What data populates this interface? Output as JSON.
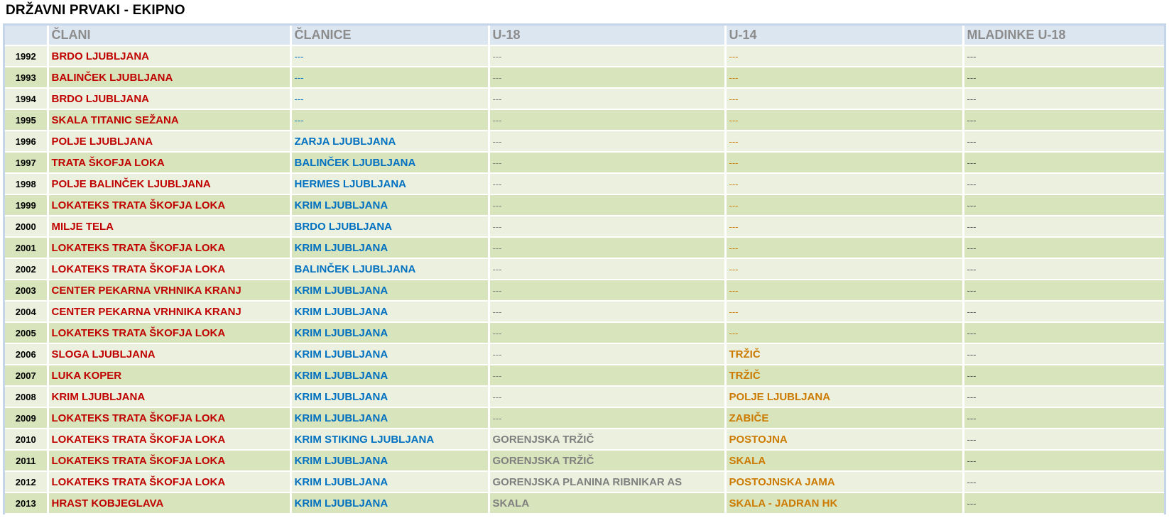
{
  "title": "DRŽAVNI PRVAKI - EKIPNO",
  "headers": {
    "year": "",
    "clani": "ČLANI",
    "clanice": "ČLANICE",
    "u18": "U-18",
    "u14": "U-14",
    "mladinke": "MLADINKE U-18"
  },
  "colors": {
    "clani": "#c00000",
    "clanice": "#0070c0",
    "u18": "#7f7f7f",
    "u14": "#cc7a00",
    "header_bg": "#dce6f1",
    "row_light": "#ebf1de",
    "row_dark": "#d8e4bc"
  },
  "rows": [
    {
      "year": "1992",
      "clani": "BRDO LJUBLJANA",
      "clanice": "---",
      "u18": "---",
      "u14": "---",
      "mladinke": "---"
    },
    {
      "year": "1993",
      "clani": "BALINČEK LJUBLJANA",
      "clanice": "---",
      "u18": "---",
      "u14": "---",
      "mladinke": "---"
    },
    {
      "year": "1994",
      "clani": "BRDO LJUBLJANA",
      "clanice": "---",
      "u18": "---",
      "u14": "---",
      "mladinke": "---"
    },
    {
      "year": "1995",
      "clani": "SKALA TITANIC SEŽANA",
      "clanice": "---",
      "u18": "---",
      "u14": "---",
      "mladinke": "---"
    },
    {
      "year": "1996",
      "clani": "POLJE LJUBLJANA",
      "clanice": "ZARJA LJUBLJANA",
      "u18": "---",
      "u14": "---",
      "mladinke": "---"
    },
    {
      "year": "1997",
      "clani": "TRATA ŠKOFJA LOKA",
      "clanice": "BALINČEK LJUBLJANA",
      "u18": "---",
      "u14": "---",
      "mladinke": "---"
    },
    {
      "year": "1998",
      "clani": "POLJE BALINČEK LJUBLJANA",
      "clanice": "HERMES LJUBLJANA",
      "u18": "---",
      "u14": "---",
      "mladinke": "---"
    },
    {
      "year": "1999",
      "clani": "LOKATEKS TRATA ŠKOFJA LOKA",
      "clanice": "KRIM LJUBLJANA",
      "u18": "---",
      "u14": "---",
      "mladinke": "---"
    },
    {
      "year": "2000",
      "clani": "MILJE TELA",
      "clanice": "BRDO LJUBLJANA",
      "u18": "---",
      "u14": "---",
      "mladinke": "---"
    },
    {
      "year": "2001",
      "clani": "LOKATEKS TRATA ŠKOFJA LOKA",
      "clanice": "KRIM LJUBLJANA",
      "u18": "---",
      "u14": "---",
      "mladinke": "---"
    },
    {
      "year": "2002",
      "clani": "LOKATEKS TRATA ŠKOFJA LOKA",
      "clanice": "BALINČEK LJUBLJANA",
      "u18": "---",
      "u14": "---",
      "mladinke": "---"
    },
    {
      "year": "2003",
      "clani": "CENTER PEKARNA VRHNIKA KRANJ",
      "clanice": "KRIM LJUBLJANA",
      "u18": "---",
      "u14": "---",
      "mladinke": "---"
    },
    {
      "year": "2004",
      "clani": "CENTER PEKARNA VRHNIKA KRANJ",
      "clanice": "KRIM LJUBLJANA",
      "u18": "---",
      "u14": "---",
      "mladinke": "---"
    },
    {
      "year": "2005",
      "clani": "LOKATEKS TRATA ŠKOFJA LOKA",
      "clanice": "KRIM LJUBLJANA",
      "u18": "---",
      "u14": "---",
      "mladinke": "---"
    },
    {
      "year": "2006",
      "clani": "SLOGA LJUBLJANA",
      "clanice": "KRIM LJUBLJANA",
      "u18": "---",
      "u14": "TRŽIČ",
      "mladinke": "---"
    },
    {
      "year": "2007",
      "clani": "LUKA KOPER",
      "clanice": "KRIM LJUBLJANA",
      "u18": "---",
      "u14": "TRŽIČ",
      "mladinke": "---"
    },
    {
      "year": "2008",
      "clani": "KRIM LJUBLJANA",
      "clanice": "KRIM LJUBLJANA",
      "u18": "---",
      "u14": "POLJE LJUBLJANA",
      "mladinke": "---"
    },
    {
      "year": "2009",
      "clani": "LOKATEKS TRATA ŠKOFJA LOKA",
      "clanice": "KRIM LJUBLJANA",
      "u18": "---",
      "u14": "ZABIČE",
      "mladinke": "---"
    },
    {
      "year": "2010",
      "clani": "LOKATEKS TRATA ŠKOFJA LOKA",
      "clanice": "KRIM STIKING LJUBLJANA",
      "u18": "GORENJSKA TRŽIČ",
      "u14": "POSTOJNA",
      "mladinke": "---"
    },
    {
      "year": "2011",
      "clani": "LOKATEKS TRATA ŠKOFJA LOKA",
      "clanice": "KRIM LJUBLJANA",
      "u18": "GORENJSKA TRŽIČ",
      "u14": "SKALA",
      "mladinke": "---"
    },
    {
      "year": "2012",
      "clani": "LOKATEKS TRATA ŠKOFJA LOKA",
      "clanice": "KRIM LJUBLJANA",
      "u18": "GORENJSKA PLANINA RIBNIKAR AS",
      "u14": "POSTOJNSKA JAMA",
      "mladinke": "---"
    },
    {
      "year": "2013",
      "clani": "HRAST KOBJEGLAVA",
      "clanice": "KRIM LJUBLJANA",
      "u18": "SKALA",
      "u14": "SKALA - JADRAN HK",
      "mladinke": "---"
    }
  ]
}
